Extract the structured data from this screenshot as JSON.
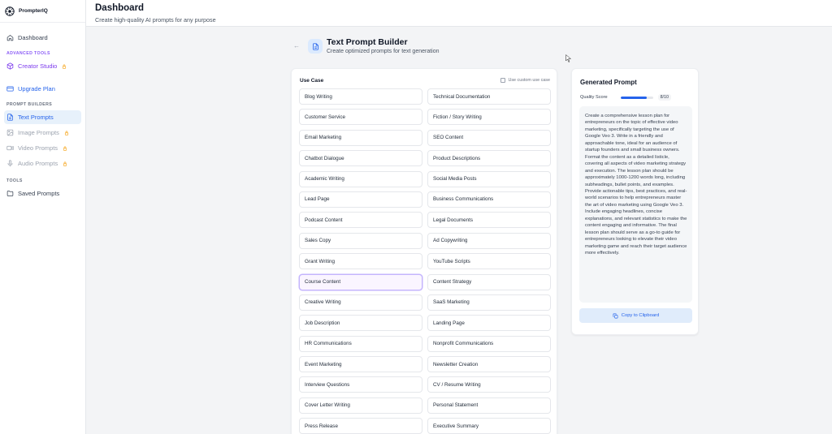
{
  "brand": {
    "name": "PrompterIQ"
  },
  "sidebar": {
    "dashboard": "Dashboard",
    "advanced_label": "ADVANCED TOOLS",
    "creator_studio": "Creator Studio",
    "upgrade": "Upgrade Plan",
    "builders_label": "PROMPT BUILDERS",
    "text_prompts": "Text Prompts",
    "image_prompts": "Image Prompts",
    "video_prompts": "Video Prompts",
    "audio_prompts": "Audio Prompts",
    "tools_label": "TOOLS",
    "saved_prompts": "Saved Prompts"
  },
  "header": {
    "title": "Dashboard",
    "subtitle": "Create high-quality AI prompts for any purpose"
  },
  "builder": {
    "back": "←",
    "title": "Text Prompt Builder",
    "subtitle": "Create optimized prompts for text generation"
  },
  "use_case": {
    "label": "Use Case",
    "custom_label": "Use custom use case",
    "selected": "Course Content",
    "items": [
      "Blog Writing",
      "Technical Documentation",
      "Customer Service",
      "Fiction / Story Writing",
      "Email Marketing",
      "SEO Content",
      "Chatbot Dialogue",
      "Product Descriptions",
      "Academic Writing",
      "Social Media Posts",
      "Lead Page",
      "Business Communications",
      "Podcast Content",
      "Legal Documents",
      "Sales Copy",
      "Ad Copywriting",
      "Grant Writing",
      "YouTube Scripts",
      "Course Content",
      "Content Strategy",
      "Creative Writing",
      "SaaS Marketing",
      "Job Description",
      "Landing Page",
      "HR Communications",
      "Nonprofit Communications",
      "Event Marketing",
      "Newsletter Creation",
      "Interview Questions",
      "CV / Resume Writing",
      "Cover Letter Writing",
      "Personal Statement",
      "Press Release",
      "Executive Summary"
    ]
  },
  "generated": {
    "title": "Generated Prompt",
    "quality_label": "Quality Score",
    "quality_value": "8/10",
    "quality_fraction": 0.8,
    "text": "Create a comprehensive lesson plan for entrepreneurs on the topic of effective video marketing, specifically targeting the use of Google Veo 3. Write in a friendly and approachable tone, ideal for an audience of startup founders and small business owners. Format the content as a detailed listicle, covering all aspects of video marketing strategy and execution. The lesson plan should be approximately 1000-1200 words long, including subheadings, bullet points, and examples. Provide actionable tips, best practices, and real-world scenarios to help entrepreneurs master the art of video marketing using Google Veo 3. Include engaging headlines, concise explanations, and relevant statistics to make the content engaging and informative. The final lesson plan should serve as a go-to guide for entrepreneurs looking to elevate their video marketing game and reach their target audience more effectively.",
    "copy_label": "Copy to Clipboard"
  }
}
